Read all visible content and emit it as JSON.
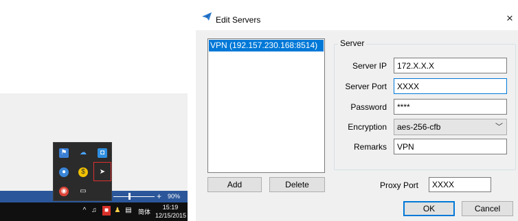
{
  "desktop": {
    "zoom_minus": "−",
    "zoom_plus": "+",
    "zoom_percent": "90%",
    "zoom_level": 0.9,
    "tray_icons": [
      "flag-icon",
      "cloud-icon",
      "chat-icon",
      "app-icon",
      "coin-icon",
      "shadowsocks-plane-icon",
      "chrome-icon",
      "display-icon"
    ],
    "taskbar": {
      "caret": "^",
      "ime": "简体",
      "time": "15:19",
      "date": "12/15/2015"
    }
  },
  "dialog": {
    "title": "Edit Servers",
    "close_label": "×",
    "servers": [
      "VPN (192.157.230.168:8514)"
    ],
    "group_label": "Server",
    "fields": {
      "server_ip": {
        "label": "Server IP",
        "value": "172.X.X.X"
      },
      "server_port": {
        "label": "Server Port",
        "value": "XXXX"
      },
      "password": {
        "label": "Password",
        "value": "****"
      },
      "encryption": {
        "label": "Encryption",
        "value": "aes-256-cfb"
      },
      "remarks": {
        "label": "Remarks",
        "value": "VPN"
      }
    },
    "add_label": "Add",
    "delete_label": "Delete",
    "proxy_port": {
      "label": "Proxy Port",
      "value": "XXXX"
    },
    "ok_label": "OK",
    "cancel_label": "Cancel"
  },
  "colors": {
    "accent": "#0078d7",
    "taskbar": "#101010",
    "word_status": "#2b579a",
    "tray_selection": "#e03030"
  }
}
